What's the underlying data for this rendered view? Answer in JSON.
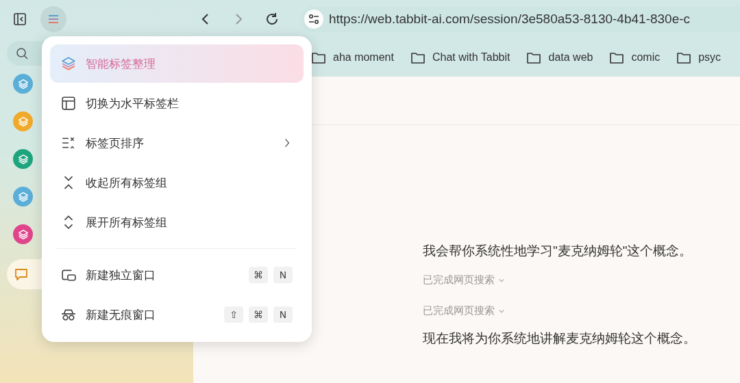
{
  "toolbar": {
    "url": "https://web.tabbit-ai.com/session/3e580a53-8130-4b41-830e-c"
  },
  "bookmarks": [
    {
      "label": "aha moment"
    },
    {
      "label": "Chat with Tabbit"
    },
    {
      "label": "data web"
    },
    {
      "label": "comic"
    },
    {
      "label": "psyc"
    }
  ],
  "sidebar": {
    "tab_groups": [
      {
        "color": "#5aaed8"
      },
      {
        "color": "#f0a92a"
      },
      {
        "color": "#1fa57e"
      },
      {
        "color": "#5aaed8"
      },
      {
        "color": "#e0458c"
      }
    ]
  },
  "content": {
    "messages": [
      {
        "kind": "text",
        "text": "我会帮你系统性地学习\"麦克纳姆轮\"这个概念。"
      },
      {
        "kind": "status",
        "text": "已完成网页搜索"
      },
      {
        "kind": "status",
        "text": "已完成网页搜索"
      },
      {
        "kind": "text",
        "text": "现在我将为你系统地讲解麦克纳姆轮这个概念。"
      }
    ]
  },
  "menu": {
    "sections": [
      [
        {
          "label": "智能标签整理",
          "highlighted": true,
          "submenu": false
        },
        {
          "label": "切换为水平标签栏",
          "highlighted": false,
          "submenu": false
        },
        {
          "label": "标签页排序",
          "highlighted": false,
          "submenu": true
        },
        {
          "label": "收起所有标签组",
          "highlighted": false,
          "submenu": false
        },
        {
          "label": "展开所有标签组",
          "highlighted": false,
          "submenu": false
        }
      ],
      [
        {
          "label": "新建独立窗口",
          "highlighted": false,
          "submenu": false,
          "shortcut": [
            "⌘",
            "N"
          ]
        },
        {
          "label": "新建无痕窗口",
          "highlighted": false,
          "submenu": false,
          "shortcut": [
            "⇧",
            "⌘",
            "N"
          ]
        }
      ]
    ]
  }
}
